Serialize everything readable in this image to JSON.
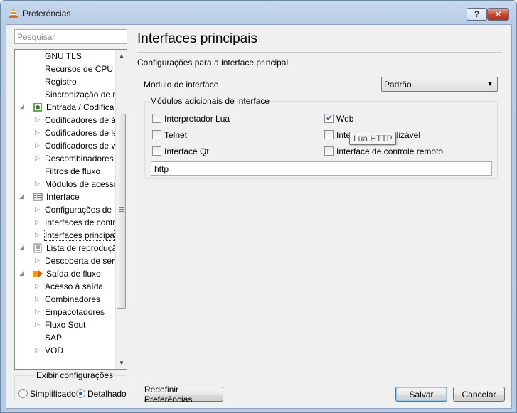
{
  "window": {
    "title": "Preferências",
    "icon": "vlc-cone-icon",
    "help_button": "?",
    "close_button": "✕"
  },
  "sidebar": {
    "search_placeholder": "Pesquisar",
    "tree": [
      {
        "label": "GNU TLS",
        "level": 1,
        "has_arrow": false
      },
      {
        "label": "Recursos de CPU",
        "level": 1,
        "has_arrow": false
      },
      {
        "label": "Registro",
        "level": 1,
        "has_arrow": false
      },
      {
        "label": "Sincronização de r",
        "level": 1,
        "has_arrow": false
      },
      {
        "label": "Entrada / Codifica",
        "level": 0,
        "icon": "input-codecs-icon"
      },
      {
        "label": "Codificadores de á",
        "level": 1,
        "has_arrow": true
      },
      {
        "label": "Codificadores de le",
        "level": 1,
        "has_arrow": true
      },
      {
        "label": "Codificadores de v",
        "level": 1,
        "has_arrow": true
      },
      {
        "label": "Descombinadores",
        "level": 1,
        "has_arrow": true
      },
      {
        "label": "Filtros de fluxo",
        "level": 1,
        "has_arrow": false
      },
      {
        "label": "Módulos de acesso",
        "level": 1,
        "has_arrow": true
      },
      {
        "label": "Interface",
        "level": 0,
        "icon": "interface-icon"
      },
      {
        "label": "Configurações de",
        "level": 1,
        "has_arrow": true
      },
      {
        "label": "Interfaces de contr",
        "level": 1,
        "has_arrow": true
      },
      {
        "label": "Interfaces principa",
        "level": 1,
        "has_arrow": true,
        "selected": true
      },
      {
        "label": "Lista de reprodução",
        "level": 0,
        "icon": "playlist-icon"
      },
      {
        "label": "Descoberta de serv",
        "level": 1,
        "has_arrow": true
      },
      {
        "label": "Saída de fluxo",
        "level": 0,
        "icon": "stream-output-icon"
      },
      {
        "label": "Acesso à saída",
        "level": 1,
        "has_arrow": true
      },
      {
        "label": "Combinadores",
        "level": 1,
        "has_arrow": true
      },
      {
        "label": "Empacotadores",
        "level": 1,
        "has_arrow": true
      },
      {
        "label": "Fluxo Sout",
        "level": 1,
        "has_arrow": true
      },
      {
        "label": "SAP",
        "level": 1,
        "has_arrow": false
      },
      {
        "label": "VOD",
        "level": 1,
        "has_arrow": true
      }
    ],
    "show_settings": {
      "legend": "Exibir configurações",
      "simple_label": "Simplificado",
      "all_label": "Detalhado",
      "selected": "Detalhado"
    }
  },
  "main": {
    "title": "Interfaces principais",
    "subtitle": "Configurações para a interface principal",
    "interface_module_label": "Módulo de interface",
    "interface_module_value": "Padrão",
    "extra_modules": {
      "legend": "Módulos adicionais de interface",
      "items": [
        {
          "label": "Interpretador Lua",
          "checked": false
        },
        {
          "label": "Web",
          "checked": true
        },
        {
          "label": "Telnet",
          "checked": false
        },
        {
          "label": "Inte",
          "label_tail": "alizável",
          "checked": false
        },
        {
          "label": "Interface Qt",
          "checked": false
        },
        {
          "label": "Interface de controle remoto",
          "checked": false
        }
      ],
      "text_value": "http"
    },
    "tooltip": "Lua HTTP"
  },
  "buttons": {
    "reset": "Redefinir Preferências",
    "save": "Salvar",
    "cancel": "Cancelar"
  }
}
